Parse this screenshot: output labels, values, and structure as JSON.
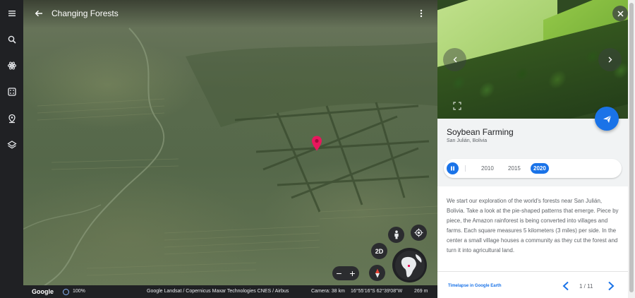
{
  "rail": {
    "items": [
      {
        "name": "menu-icon"
      },
      {
        "name": "search-icon"
      },
      {
        "name": "voyager-icon"
      },
      {
        "name": "feeling-lucky-icon"
      },
      {
        "name": "projects-icon"
      },
      {
        "name": "layers-icon"
      }
    ]
  },
  "header": {
    "title": "Changing Forests"
  },
  "map_controls": {
    "view_mode_label": "2D",
    "zoom_out": "−",
    "zoom_in": "+"
  },
  "statusbar": {
    "logo": "Google",
    "zoom": "100%",
    "credits": "Google   Landsat / Copernicus   Maxar Technologies   CNES / Airbus",
    "camera": "Camera: 38 km",
    "coords": "16°55'16\"S 62°39'08\"W",
    "elevation": "269 m"
  },
  "panel": {
    "title": "Soybean Farming",
    "subtitle": "San Julián, Bolivia",
    "timeline": {
      "years": [
        "2010",
        "2015",
        "2020"
      ],
      "selected": "2020"
    },
    "description": "We start our exploration of the world's forests near San Julián, Bolivia. Take a look at the pie-shaped patterns that emerge. Piece by piece, the Amazon rainforest is being converted into villages and farms. Each square measures 5 kilometers (3 miles) per side. In the center a small village houses a community as they cut the forest and turn it into agricultural land.",
    "footer_link": "Timelapse in Google Earth",
    "pager": "1 / 11"
  },
  "colors": {
    "accent": "#1a73e8",
    "pin": "#e8175d",
    "dark_chrome": "#202124"
  }
}
